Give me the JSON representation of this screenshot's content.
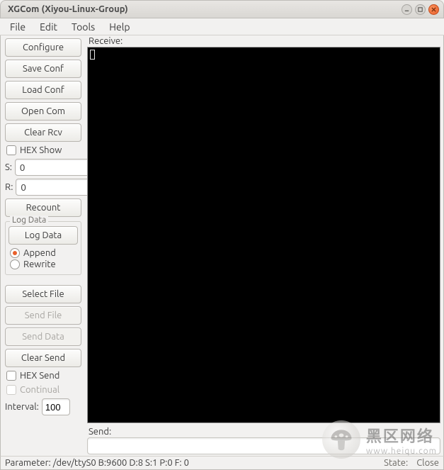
{
  "window": {
    "title": "XGCom (Xiyou-Linux-Group)"
  },
  "menu": {
    "file": "File",
    "edit": "Edit",
    "tools": "Tools",
    "help": "Help"
  },
  "buttons": {
    "configure": "Configure",
    "save_conf": "Save Conf",
    "load_conf": "Load Conf",
    "open_com": "Open Com",
    "clear_rcv": "Clear Rcv",
    "recount": "Recount",
    "log_data": "Log Data",
    "select_file": "Select File",
    "send_file": "Send File",
    "send_data": "Send Data",
    "clear_send": "Clear Send"
  },
  "checks": {
    "hex_show": "HEX Show",
    "hex_send": "HEX Send",
    "continual": "Continual"
  },
  "radios": {
    "append": "Append",
    "rewrite": "Rewrite"
  },
  "counters": {
    "s_label": "S:",
    "s_value": "0",
    "r_label": "R:",
    "r_value": "0"
  },
  "logdata_frame_title": "Log Data",
  "interval": {
    "label": "Interval:",
    "value": "100"
  },
  "right": {
    "receive_label": "Receive:",
    "send_label": "Send:"
  },
  "status": {
    "left": "Parameter: /dev/ttyS0 B:9600 D:8 S:1 P:0 F: 0",
    "state_label": "State:",
    "state_value": "Close"
  },
  "watermark": {
    "cn": "黑区网络",
    "url": "www.heiqu.com"
  }
}
